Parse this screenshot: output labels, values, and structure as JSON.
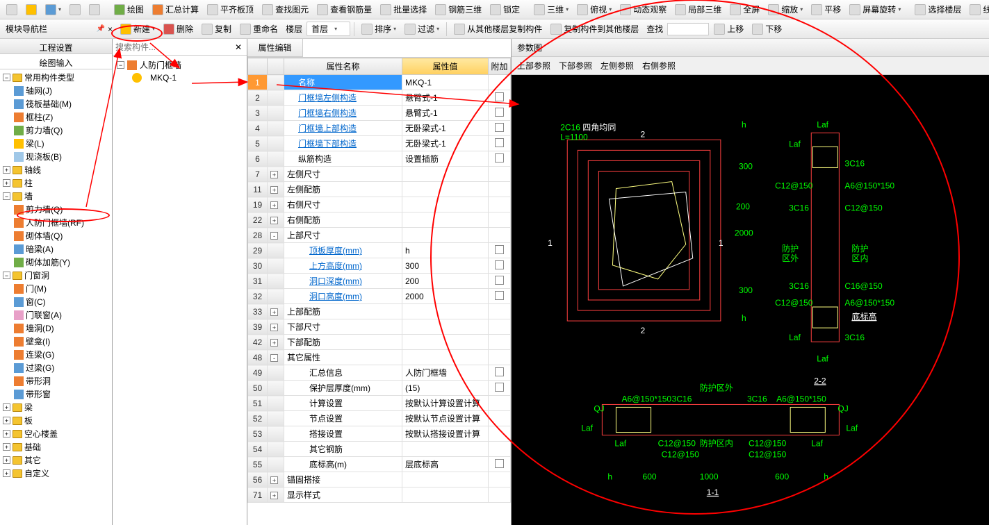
{
  "toolbar1": {
    "draw": "绘图",
    "sum": "汇总计算",
    "flatten": "平齐板顶",
    "find_elem": "查找图元",
    "view_rebar": "查看钢筋量",
    "batch_sel": "批量选择",
    "rebar3d": "钢筋三维",
    "lock": "锁定",
    "view3d": "三维",
    "top_view": "俯视",
    "dyn_view": "动态观察",
    "local3d": "局部三维",
    "fullscreen": "全屏",
    "zoom": "缩放",
    "pan": "平移",
    "screen_rotate": "屏幕旋转",
    "select_floor": "选择楼层",
    "line": "线"
  },
  "toolbar2": {
    "new": "新建",
    "del": "删除",
    "copy": "复制",
    "rename": "重命名",
    "floor": "楼层",
    "first_floor": "首层",
    "sort": "排序",
    "filter": "过滤",
    "copy_from": "从其他楼层复制构件",
    "copy_to": "复制构件到其他楼层",
    "find": "查找",
    "move_up": "上移",
    "move_down": "下移"
  },
  "nav": {
    "title": "模块导航栏",
    "tab_proj": "工程设置",
    "tab_draw": "绘图输入",
    "root": "常用构件类型",
    "items": {
      "axis_net": "轴网(J)",
      "raft": "筏板基础(M)",
      "col": "框柱(Z)",
      "shear": "剪力墙(Q)",
      "beam": "梁(L)",
      "slab": "现浇板(B)",
      "g_axis": "轴线",
      "g_col": "柱",
      "g_wall": "墙",
      "w_shear": "剪力墙(Q)",
      "w_rf": "人防门框墙(RF)",
      "w_masonry": "砌体墙(Q)",
      "w_dark": "暗梁(A)",
      "w_rein": "砌体加筋(Y)",
      "g_opening": "门窗洞",
      "o_door": "门(M)",
      "o_window": "窗(C)",
      "o_dw": "门联窗(A)",
      "o_hole": "墙洞(D)",
      "o_niche": "壁龛(I)",
      "o_lintol": "连梁(G)",
      "o_lintel": "过梁(G)",
      "o_strip": "带形洞",
      "o_stripw": "带形窗",
      "g_beam": "梁",
      "g_slab": "板",
      "g_hollow": "空心楼盖",
      "g_found": "基础",
      "g_other": "其它",
      "g_custom": "自定义"
    }
  },
  "search": {
    "placeholder": "搜索构件..."
  },
  "mid": {
    "parent": "人防门框墙",
    "item": "MKQ-1"
  },
  "prop": {
    "tab": "属性编辑",
    "col_name": "属性名称",
    "col_val": "属性值",
    "col_extra": "附加",
    "rows": [
      {
        "n": "1",
        "name": "名称",
        "val": "MKQ-1",
        "sel": true
      },
      {
        "n": "2",
        "name": "门框墙左侧构造",
        "val": "悬臂式-1",
        "link": true,
        "ck": true
      },
      {
        "n": "3",
        "name": "门框墙右侧构造",
        "val": "悬臂式-1",
        "link": true,
        "ck": true
      },
      {
        "n": "4",
        "name": "门框墙上部构造",
        "val": "无卧梁式-1",
        "link": true,
        "ck": true
      },
      {
        "n": "5",
        "name": "门框墙下部构造",
        "val": "无卧梁式-1",
        "link": true,
        "ck": true
      },
      {
        "n": "6",
        "name": "纵筋构造",
        "val": "设置插筋",
        "ck": true
      },
      {
        "n": "7",
        "name": "左侧尺寸",
        "group": "+"
      },
      {
        "n": "11",
        "name": "左侧配筋",
        "group": "+"
      },
      {
        "n": "19",
        "name": "右侧尺寸",
        "group": "+"
      },
      {
        "n": "22",
        "name": "右侧配筋",
        "group": "+"
      },
      {
        "n": "28",
        "name": "上部尺寸",
        "group": "-"
      },
      {
        "n": "29",
        "name": "顶板厚度(mm)",
        "val": "h",
        "indent": 2,
        "link": true,
        "ck": true
      },
      {
        "n": "30",
        "name": "上方高度(mm)",
        "val": "300",
        "indent": 2,
        "link": true,
        "ck": true
      },
      {
        "n": "31",
        "name": "洞口深度(mm)",
        "val": "200",
        "indent": 2,
        "link": true,
        "ck": true
      },
      {
        "n": "32",
        "name": "洞口高度(mm)",
        "val": "2000",
        "indent": 2,
        "link": true,
        "ck": true
      },
      {
        "n": "33",
        "name": "上部配筋",
        "group": "+"
      },
      {
        "n": "39",
        "name": "下部尺寸",
        "group": "+"
      },
      {
        "n": "42",
        "name": "下部配筋",
        "group": "+"
      },
      {
        "n": "48",
        "name": "其它属性",
        "group": "-"
      },
      {
        "n": "49",
        "name": "汇总信息",
        "val": "人防门框墙",
        "indent": 2,
        "ck": true
      },
      {
        "n": "50",
        "name": "保护层厚度(mm)",
        "val": "(15)",
        "indent": 2,
        "ck": true
      },
      {
        "n": "51",
        "name": "计算设置",
        "val": "按默认计算设置计算",
        "indent": 2
      },
      {
        "n": "52",
        "name": "节点设置",
        "val": "按默认节点设置计算",
        "indent": 2
      },
      {
        "n": "53",
        "name": "搭接设置",
        "val": "按默认搭接设置计算",
        "indent": 2
      },
      {
        "n": "54",
        "name": "其它钢筋",
        "val": "",
        "indent": 2
      },
      {
        "n": "55",
        "name": "底标高(m)",
        "val": "层底标高",
        "indent": 2,
        "ck": true
      },
      {
        "n": "56",
        "name": "锚固搭接",
        "group": "+"
      },
      {
        "n": "71",
        "name": "显示样式",
        "group": "+"
      }
    ]
  },
  "param": {
    "title": "参数图",
    "tabs": [
      "上部参照",
      "下部参照",
      "左侧参照",
      "右侧参照"
    ]
  },
  "cad": {
    "label_2C16": "2C16",
    "label_corner": "四角均同",
    "L": "L=1100",
    "h": "h",
    "v300_a": "300",
    "v2000": "2000",
    "v300_b": "300",
    "laf": "Laf",
    "c3c16": "3C16",
    "c12_150": "C12@150",
    "a6_150": "A6@150*150",
    "c16_150": "C16@150",
    "protect_out": "防护区外",
    "protect_in": "防护区内",
    "protect_out2": "防护\n区外",
    "protect_in2": "防护\n区内",
    "bottom_elev": "底标高",
    "sec22": "2-2",
    "sec11": "1-1",
    "qj": "QJ",
    "v200": "200",
    "v600": "600",
    "v1000": "1000",
    "mark1": "1",
    "mark2": "2"
  }
}
